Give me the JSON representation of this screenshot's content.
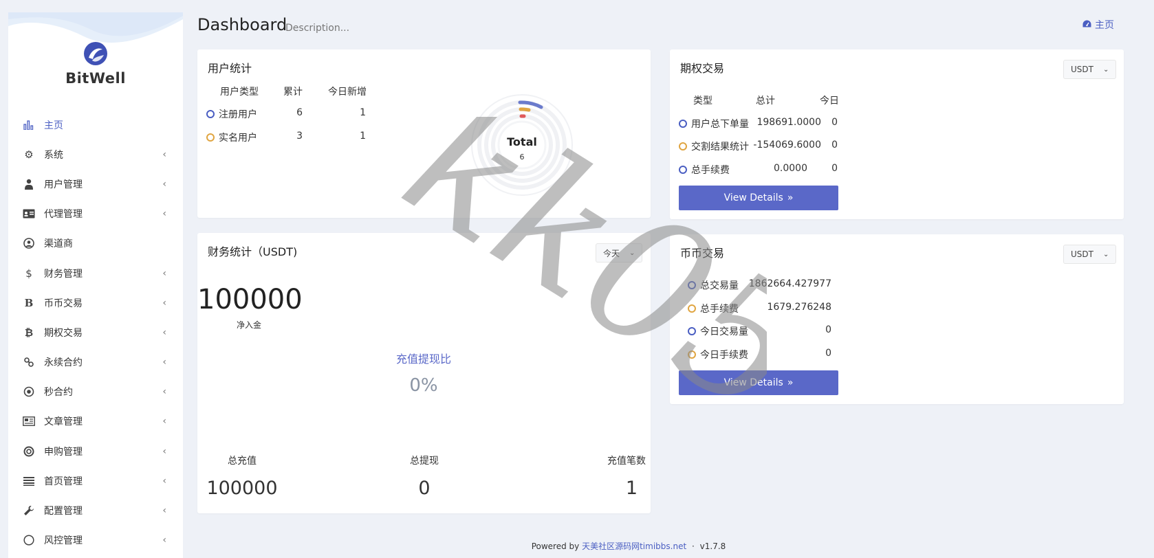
{
  "brand": {
    "name": "BitWell"
  },
  "header": {
    "title": "Dashboard",
    "description": "Description...",
    "home_link": "主页"
  },
  "sidebar": {
    "items": [
      {
        "label": "主页",
        "icon": "bar-chart-icon"
      },
      {
        "label": "系统",
        "icon": "gear-icon"
      },
      {
        "label": "用户管理",
        "icon": "user-tie-icon"
      },
      {
        "label": "代理管理",
        "icon": "id-card-icon"
      },
      {
        "label": "渠道商",
        "icon": "user-circle-icon"
      },
      {
        "label": "财务管理",
        "icon": "dollar-icon"
      },
      {
        "label": "币币交易",
        "icon": "b-letter-icon"
      },
      {
        "label": "期权交易",
        "icon": "bitcoin-icon"
      },
      {
        "label": "永续合约",
        "icon": "link-icon"
      },
      {
        "label": "秒合约",
        "icon": "dot-circle-icon"
      },
      {
        "label": "文章管理",
        "icon": "newspaper-icon"
      },
      {
        "label": "申购管理",
        "icon": "lifebuoy-icon"
      },
      {
        "label": "首页管理",
        "icon": "list-lines-icon"
      },
      {
        "label": "配置管理",
        "icon": "wrench-icon"
      },
      {
        "label": "风控管理",
        "icon": "circle-icon"
      }
    ]
  },
  "user_stats": {
    "title": "用户统计",
    "headers": [
      "用户类型",
      "累计",
      "今日新增"
    ],
    "rows": [
      {
        "type": "注册用户",
        "total": "6",
        "today": "1"
      },
      {
        "type": "实名用户",
        "total": "3",
        "today": "1"
      }
    ],
    "donut": {
      "label": "Total",
      "value": "6"
    }
  },
  "finance": {
    "title": "财务统计（USDT)",
    "period": "今天",
    "net_inflow": "100000",
    "net_inflow_label": "净入金",
    "ratio_label": "充值提现比",
    "ratio_value": "0%",
    "stats": [
      {
        "label": "总充值",
        "value": "100000"
      },
      {
        "label": "总提现",
        "value": "0"
      },
      {
        "label": "充值笔数",
        "value": "1"
      }
    ]
  },
  "options_trade": {
    "title": "期权交易",
    "currency": "USDT",
    "headers": [
      "类型",
      "总计",
      "今日"
    ],
    "rows": [
      {
        "type": "用户总下单量",
        "total": "198691.0000",
        "today": "0"
      },
      {
        "type": "交割结果统计",
        "total": "-154069.6000",
        "today": "0"
      },
      {
        "type": "总手续费",
        "total": "0.0000",
        "today": "0"
      }
    ],
    "button": "View Details"
  },
  "coin_trade": {
    "title": "币币交易",
    "currency": "USDT",
    "rows": [
      {
        "type": "总交易量",
        "value": "1862664.427977"
      },
      {
        "type": "总手续费",
        "value": "1679.276248"
      },
      {
        "type": "今日交易量",
        "value": "0"
      },
      {
        "type": "今日手续费",
        "value": "0"
      }
    ],
    "button": "View Details"
  },
  "footer": {
    "powered": "Powered by",
    "site": "天美社区源码网timibbs.net",
    "sep": "·",
    "version": "v1.7.8"
  },
  "watermark": "kk058",
  "colors": {
    "accent": "#5a68c8",
    "link": "#4a5ec2",
    "yellow": "#e0a541",
    "red": "#e05a5a",
    "background": "#eef1f7"
  }
}
